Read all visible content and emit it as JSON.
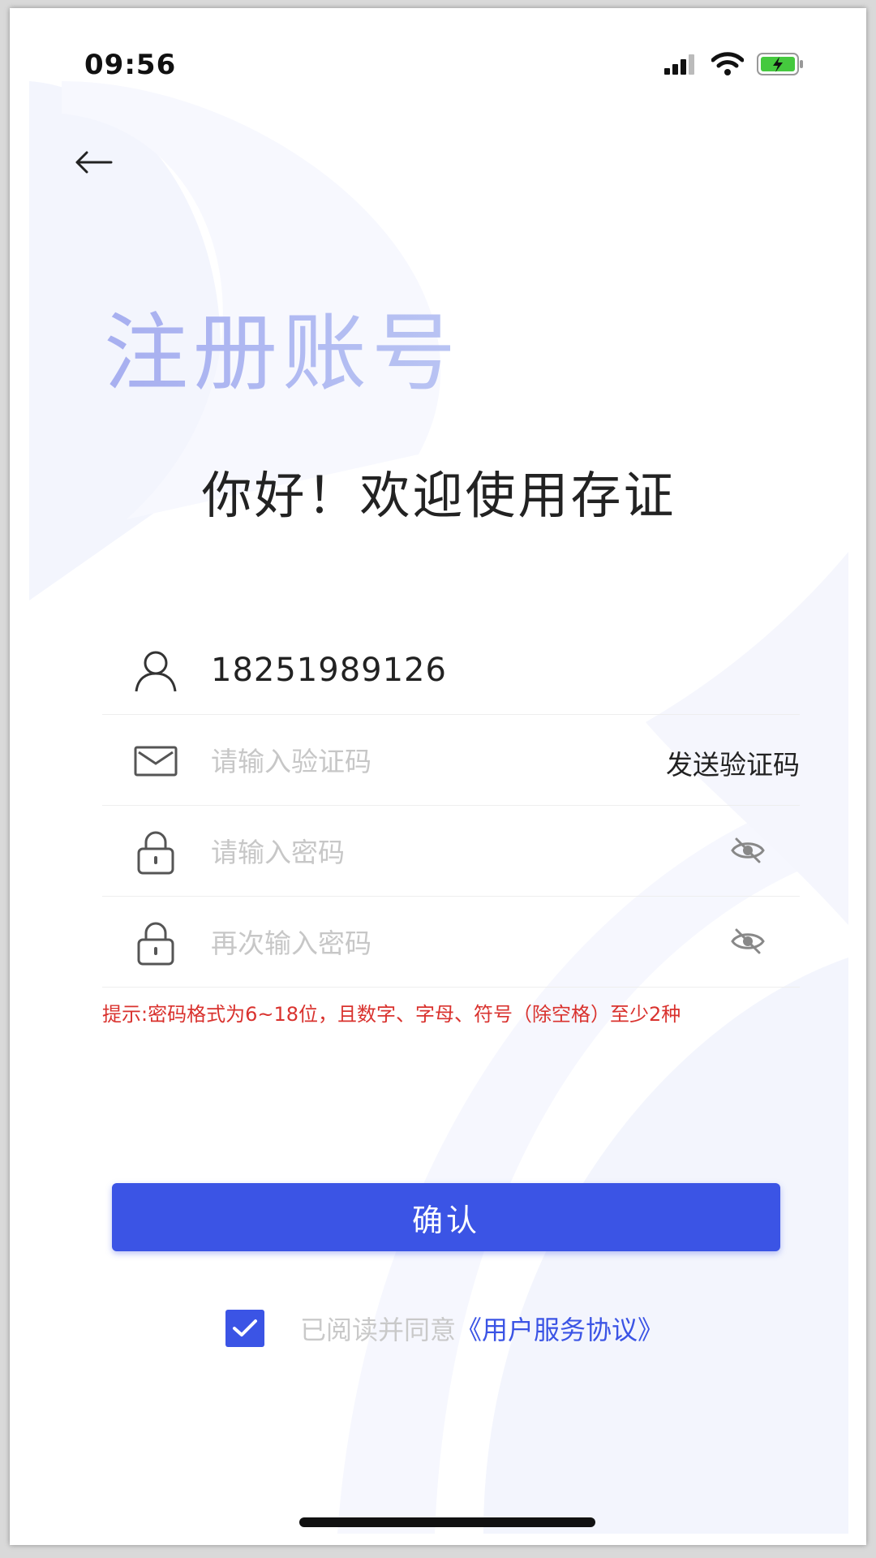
{
  "status_bar": {
    "time": "09:56",
    "icons": [
      "signal-icon",
      "wifi-icon",
      "battery-charging-icon"
    ]
  },
  "header": {
    "back_icon": "arrow-left-icon"
  },
  "title": "注册账号",
  "welcome": "你好！欢迎使用存证",
  "form": {
    "phone": {
      "icon": "user-icon",
      "value": "18251989126"
    },
    "code": {
      "icon": "envelope-icon",
      "placeholder": "请输入验证码",
      "send_label": "发送验证码"
    },
    "password": {
      "icon": "lock-icon",
      "placeholder": "请输入密码",
      "toggle_icon": "eye-off-icon"
    },
    "confirm_password": {
      "icon": "lock-icon",
      "placeholder": "再次输入密码",
      "toggle_icon": "eye-off-icon"
    }
  },
  "hint": "提示:密码格式为6~18位，且数字、字母、符号（除空格）至少2种",
  "confirm_button": "确认",
  "agreement": {
    "checked": true,
    "text": "已阅读并同意",
    "link": "《用户服务协议》"
  },
  "colors": {
    "primary": "#3b54e5",
    "title": "#aab3f0",
    "hint": "#d9322e",
    "placeholder": "#c7c7c7"
  }
}
